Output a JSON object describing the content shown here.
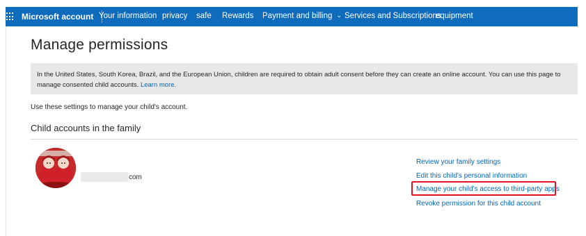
{
  "nav": {
    "brand": "Microsoft account",
    "items": [
      {
        "label": "Your information"
      },
      {
        "label": "privacy"
      },
      {
        "label": "safe"
      },
      {
        "label": "Rewards"
      },
      {
        "label": "Payment and billing",
        "has_dropdown": true
      },
      {
        "label": "Services and Subscriptions"
      },
      {
        "label": "equipment"
      }
    ],
    "icon": "waffle-grid-icon",
    "bg_color": "#0f6cbd"
  },
  "page": {
    "title": "Manage permissions",
    "notice": {
      "text": "In the United States, South Korea, Brazil, and the European Union, children are required to obtain adult consent before they can create an online account. You can use this page to manage consented child accounts.",
      "link": "Learn more."
    },
    "intro": "Use these settings to manage your child's account.",
    "section_title": "Child accounts in the family"
  },
  "child": {
    "email_suffix": "com",
    "actions": [
      {
        "label": "Review your family settings"
      },
      {
        "label": "Edit this child's personal information"
      },
      {
        "label": "Manage your child's access to third-party apps",
        "highlighted": true
      },
      {
        "label": "Revoke permission for this child account"
      }
    ]
  },
  "colors": {
    "link": "#0066b8",
    "notice_bg": "#e8e8e8",
    "highlight": "#e81123"
  }
}
